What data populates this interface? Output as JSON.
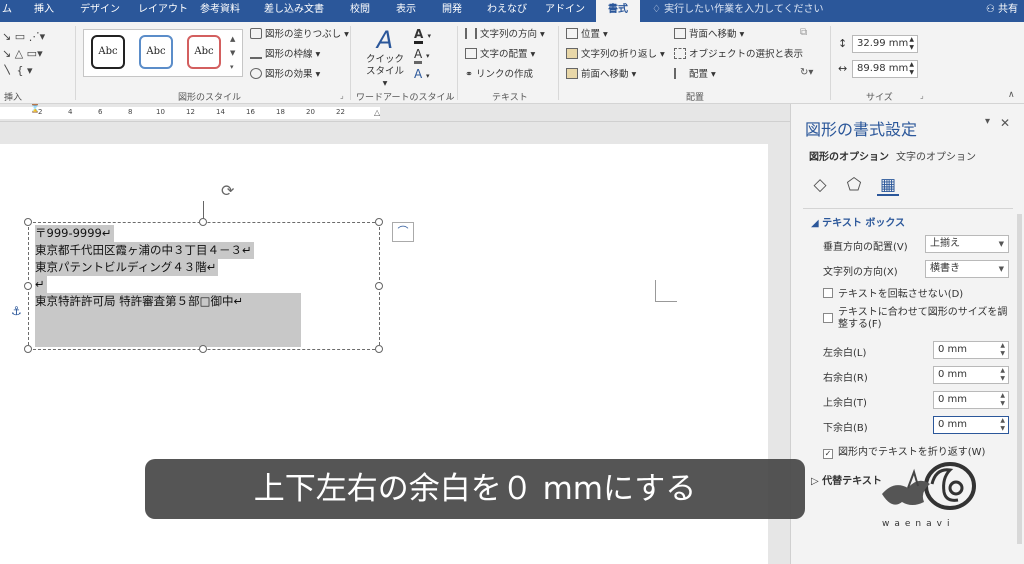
{
  "tabs": [
    {
      "label": "ム",
      "active": false
    },
    {
      "label": "挿入",
      "active": false
    },
    {
      "label": "デザイン",
      "active": false
    },
    {
      "label": "レイアウト",
      "active": false
    },
    {
      "label": "参考資料",
      "active": false
    },
    {
      "label": "差し込み文書",
      "active": false
    },
    {
      "label": "校閲",
      "active": false
    },
    {
      "label": "表示",
      "active": false
    },
    {
      "label": "開発",
      "active": false
    },
    {
      "label": "わえなび",
      "active": false
    },
    {
      "label": "アドイン",
      "active": false
    },
    {
      "label": "書式",
      "active": true
    }
  ],
  "tell_me": "実行したい作業を入力してください",
  "share": "共有",
  "colors": {
    "accent": "#2b579a",
    "selection": "#c8c8c8",
    "caption_bg": "#464646"
  },
  "ribbon": {
    "insert_group_label": "挿入",
    "shape_styles": {
      "label": "図形のスタイル",
      "preview_text": [
        "Abc",
        "Abc",
        "Abc"
      ],
      "fill": "図形の塗りつぶし",
      "outline": "図形の枠線",
      "effects": "図形の効果"
    },
    "wordart": {
      "label": "ワードアートのスタイル",
      "quick_style_1": "クイック",
      "quick_style_2": "スタイル",
      "glyph": "A"
    },
    "text": {
      "label": "テキスト",
      "direction": "文字列の方向",
      "align": "文字の配置",
      "link": "リンクの作成"
    },
    "arrange": {
      "label": "配置",
      "position": "位置",
      "wrap": "文字列の折り返し",
      "forward": "前面へ移動",
      "backward": "背面へ移動",
      "selection": "オブジェクトの選択と表示",
      "align": "配置"
    },
    "size": {
      "label": "サイズ",
      "height": "32.99 mm",
      "width": "89.98 mm"
    }
  },
  "ruler_numbers": [
    "2",
    "4",
    "6",
    "8",
    "10",
    "12",
    "14",
    "16",
    "18",
    "20",
    "22"
  ],
  "document": {
    "lines": [
      "〒999-9999↵",
      "東京都千代田区霞ヶ浦の中３丁目４－３↵",
      "東京パテントビルディング４３階↵",
      "↵",
      "東京特許許可局 特許審査第５部□御中↵"
    ]
  },
  "pane": {
    "title": "図形の書式設定",
    "tab_shape": "図形のオプション",
    "tab_text": "文字のオプション",
    "icons": [
      "fill-line-icon",
      "shape-effects-icon",
      "layout-properties-icon"
    ],
    "section": "テキスト ボックス",
    "vertical_align_label": "垂直方向の配置(V)",
    "vertical_align_value": "上揃え",
    "text_direction_label": "文字列の方向(X)",
    "text_direction_value": "横書き",
    "no_rotate_label": "テキストを回転させない(D)",
    "no_rotate_checked": false,
    "autofit_label_1": "テキストに合わせて図形のサイズを調整する(F)",
    "autofit_checked": false,
    "left_margin_label": "左余白(L)",
    "left_margin_value": "0 mm",
    "right_margin_label": "右余白(R)",
    "right_margin_value": "0 mm",
    "top_margin_label": "上余白(T)",
    "top_margin_value": "0 mm",
    "bottom_margin_label": "下余白(B)",
    "bottom_margin_value": "0 mm",
    "wrap_label": "図形内でテキストを折り返す(W)",
    "wrap_checked": true,
    "alt_text": "代替テキスト"
  },
  "caption": "上下左右の余白を０ mmにする",
  "logo_text": "waenavi"
}
